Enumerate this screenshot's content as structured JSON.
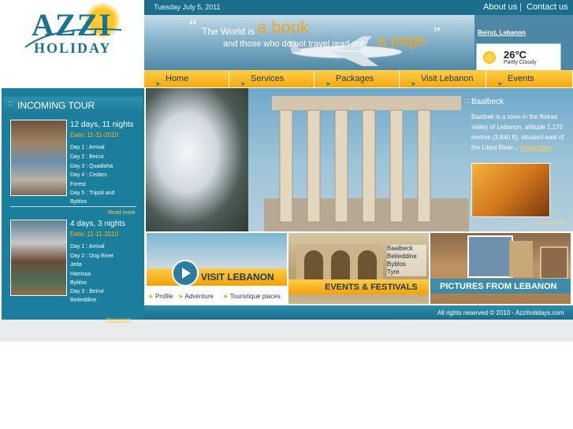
{
  "header": {
    "logo_line1": "AZZI",
    "logo_line2": "HOLIDAY",
    "date": "Tuesday July 5, 2011",
    "about_link": "About us",
    "separator": "|",
    "contact_link": "Contact us"
  },
  "banner": {
    "quote_open": "“",
    "line1": "The World is",
    "highlight1": "a book",
    "line2": "and those who do not travel read only",
    "highlight2": "a page",
    "quote_close": "”"
  },
  "weather": {
    "city": "Beirut, Lebanon",
    "temperature": "26°C",
    "condition": "Partly Cloudy",
    "icon": "sun-icon"
  },
  "nav": {
    "items": [
      {
        "label": "Home"
      },
      {
        "label": "Services"
      },
      {
        "label": "Packages"
      },
      {
        "label": "Visit Lebanon"
      },
      {
        "label": "Events"
      }
    ]
  },
  "incoming": {
    "title": "INCOMING TOUR",
    "tours": [
      {
        "title": "12 days, 11 nights",
        "date": "Date: 11-11-2010",
        "days": [
          "Day 1 : Arrival",
          "Day 2 : Beirut",
          "Day 3 : Quadisha",
          "Day 4 : Cedars",
          "Forest",
          "Day 5 : Tripoli and",
          "Byblos"
        ],
        "read_more": "Read more"
      },
      {
        "title": "4 days, 3 nights",
        "date": "Date: 11-11-2010",
        "days": [
          "Day 1 : Arrival",
          "Day 2 : Dog River",
          "Jeita",
          "Harrissa",
          "Byblos",
          "Day 3 : Beirut",
          "Beiteddine"
        ]
      }
    ],
    "more_events": "More events"
  },
  "hero": {
    "title": "Baalbeck",
    "text": "Baalbek is a town in the Bekaa Valley of Lebanon, altitude 1,170 metres (3,840 ft), situated east of the Litani River...",
    "read_more": "Read more",
    "more_pictures": "More pictures"
  },
  "tiles": {
    "visit": {
      "title": "VISIT LEBANON",
      "links": [
        "Profile",
        "Adventure",
        "Touristique places"
      ]
    },
    "events": {
      "title": "EVENTS & FESTIVALS",
      "places": [
        "Baalbeck",
        "Beiteddine",
        "Byblos",
        "Tyre"
      ]
    },
    "pictures": {
      "title": "PICTURES FROM LEBANON"
    }
  },
  "footer": {
    "copyright": "All rights reserved © 2010 - Azziholidays.com"
  },
  "colors": {
    "primary": "#1b6f8c",
    "accent": "#f6a80d",
    "highlight": "#f1a51c"
  }
}
